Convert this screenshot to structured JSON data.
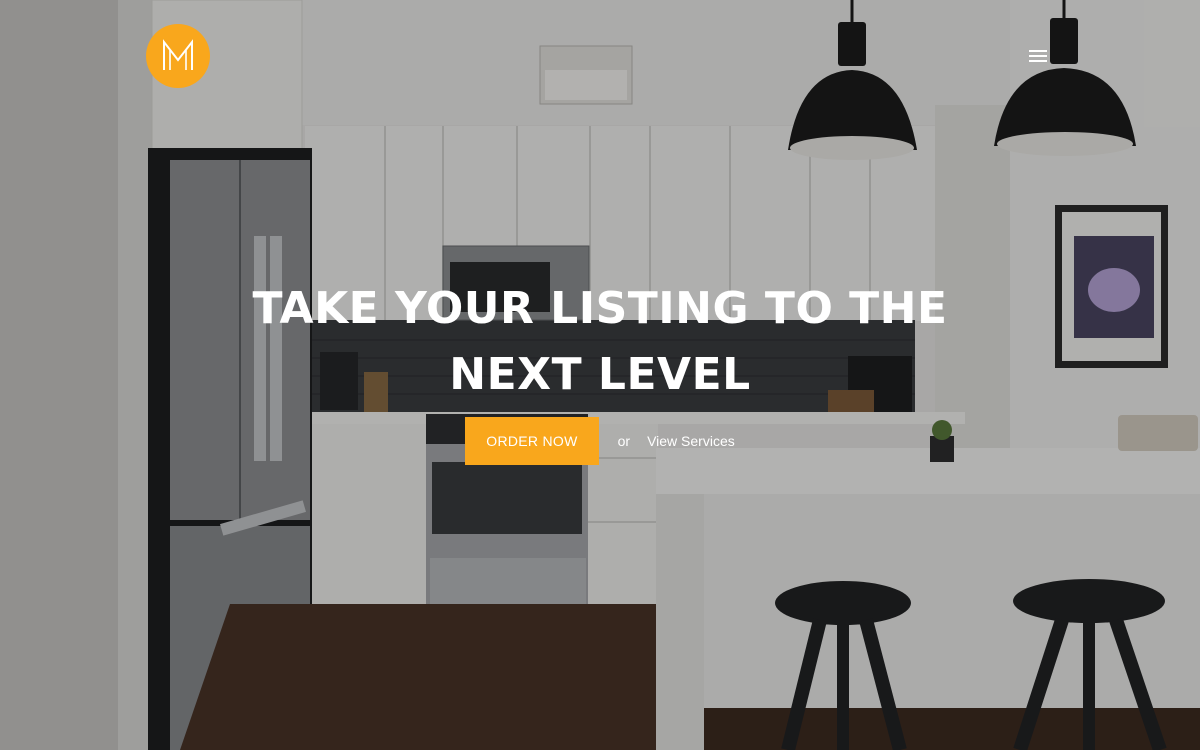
{
  "colors": {
    "accent": "#f9a71c",
    "text_on_dark": "#ffffff"
  },
  "header": {
    "logo_icon": "monogram-logo",
    "menu_icon": "hamburger-menu-icon"
  },
  "hero": {
    "background": "kitchen-interior-photo",
    "headline_line1": "TAKE YOUR LISTING TO THE",
    "headline_line2": "NEXT LEVEL",
    "order_button_label": "ORDER NOW",
    "separator_text": "or",
    "services_link_label": "View Services"
  }
}
